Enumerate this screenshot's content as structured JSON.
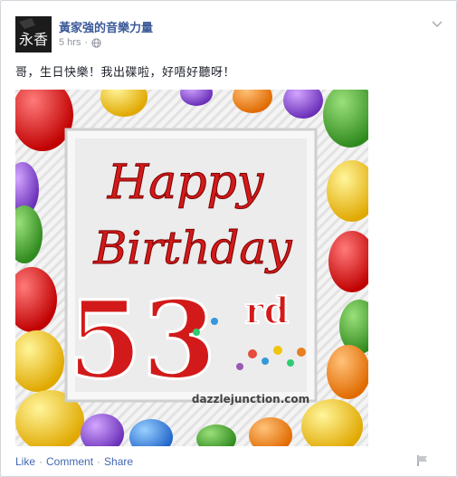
{
  "post": {
    "page_name": "黃家強的音樂力量",
    "timestamp": "5 hrs",
    "separator": "·",
    "privacy_icon": "globe-icon",
    "text": "哥，生日快樂！我出碟啦，好唔好聽呀！",
    "avatar_text": "永香"
  },
  "image": {
    "line1": "Happy",
    "line2": "Birthday",
    "number": "53",
    "suffix": "rd",
    "watermark": "dazzlejunction.com"
  },
  "actions": {
    "like": "Like",
    "comment": "Comment",
    "share": "Share",
    "dot": "·"
  }
}
